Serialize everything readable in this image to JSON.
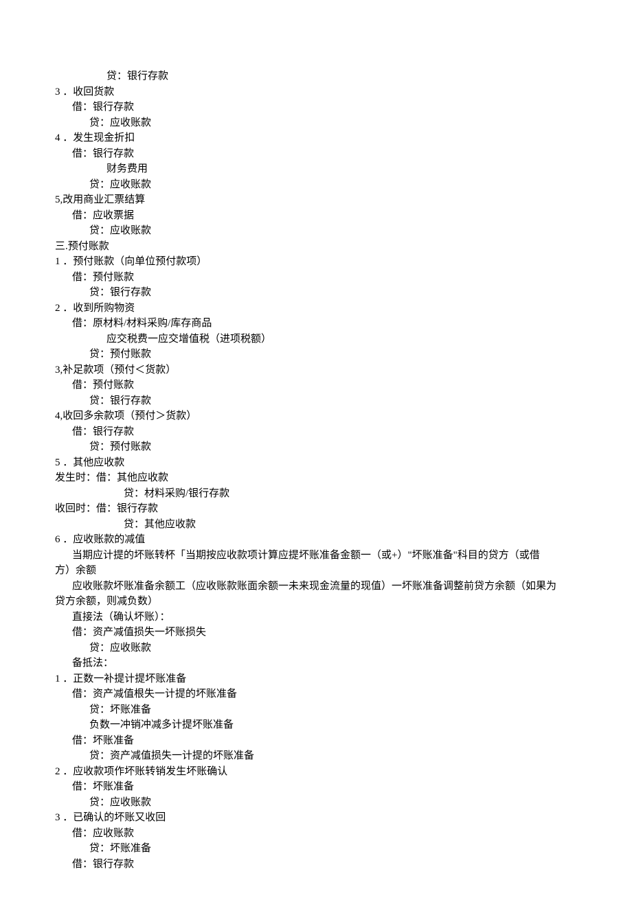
{
  "lines": [
    {
      "indent": 3,
      "text": "贷：银行存款"
    },
    {
      "indent": 0,
      "text": "3 ．收回货款"
    },
    {
      "indent": 1,
      "text": "借：银行存款"
    },
    {
      "indent": 2,
      "text": "贷：应收账款"
    },
    {
      "indent": 0,
      "text": "4 ．发生现金折扣"
    },
    {
      "indent": 1,
      "text": "借：银行存款"
    },
    {
      "indent": 3,
      "text": "财务费用"
    },
    {
      "indent": 2,
      "text": "贷：应收账款"
    },
    {
      "indent": 0,
      "text": "5,改用商业汇票结算"
    },
    {
      "indent": 1,
      "text": "借：应收票据"
    },
    {
      "indent": 2,
      "text": "贷：应收账款"
    },
    {
      "indent": 0,
      "text": "三.预付账款"
    },
    {
      "indent": 0,
      "text": "1 ．预付账款（向单位预付款项）"
    },
    {
      "indent": 1,
      "text": "借：预付账款"
    },
    {
      "indent": 2,
      "text": "贷：银行存款"
    },
    {
      "indent": 0,
      "text": "2 ．收到所购物资"
    },
    {
      "indent": 1,
      "text": "借：原材料/材料采购/库存商品"
    },
    {
      "indent": 3,
      "text": "应交税费一应交增值税（进项税额）"
    },
    {
      "indent": 2,
      "text": "贷：预付账款"
    },
    {
      "indent": 0,
      "text": "3,补足款项（预付＜货款）"
    },
    {
      "indent": 1,
      "text": "借：预付账款"
    },
    {
      "indent": 2,
      "text": "贷：银行存款"
    },
    {
      "indent": 0,
      "text": "4,收回多余款项（预付＞货款）"
    },
    {
      "indent": 1,
      "text": "借：银行存款"
    },
    {
      "indent": 2,
      "text": "贷：预付账款"
    },
    {
      "indent": 0,
      "text": "5 ．其他应收款"
    },
    {
      "indent": 0,
      "text": "发生时：借：其他应收款"
    },
    {
      "indent": 4,
      "text": "贷：材料采购/银行存款"
    },
    {
      "indent": 0,
      "text": "收回时：借：银行存款"
    },
    {
      "indent": 4,
      "text": "贷：其他应收款"
    },
    {
      "indent": 0,
      "text": "6 ．应收账款的减值"
    },
    {
      "indent": 1,
      "text": "当期应计提的坏账转杯「当期按应收款项计算应提坏账准备金额一（或+）\"坏账准备\"科目的贷方（或借"
    },
    {
      "indent": 0,
      "text": "方）余额"
    },
    {
      "indent": 1,
      "text": "应收账款坏账准备余额工（应收账款账面余额一未来现金流量的现值）一坏账准备调整前贷方余额（如果为"
    },
    {
      "indent": 0,
      "text": "贷方余额，则减负数）"
    },
    {
      "indent": 1,
      "text": "直接法（确认坏账）："
    },
    {
      "indent": 1,
      "text": "借：资产减值损失一坏账损失"
    },
    {
      "indent": 2,
      "text": "贷：应收账款"
    },
    {
      "indent": 1,
      "text": "备抵法："
    },
    {
      "indent": 0,
      "text": "1 ．正数一补提计提坏账准备"
    },
    {
      "indent": 1,
      "text": "借：资产减值根失一计提的坏账准备"
    },
    {
      "indent": 2,
      "text": "贷：坏账准备"
    },
    {
      "indent": 2,
      "text": "负数一冲销冲减多计提坏账准备"
    },
    {
      "indent": 1,
      "text": "借：坏账准备"
    },
    {
      "indent": 2,
      "text": "贷：资产减值损失一计提的坏账准备"
    },
    {
      "indent": 0,
      "text": "2 ．应收款项作坏账转销发生坏账确认"
    },
    {
      "indent": 1,
      "text": "借：坏账准备"
    },
    {
      "indent": 2,
      "text": "贷：应收账款"
    },
    {
      "indent": 0,
      "text": "3 ．已确认的坏账又收回"
    },
    {
      "indent": 1,
      "text": "借：应收账款"
    },
    {
      "indent": 2,
      "text": "贷：坏账准备"
    },
    {
      "indent": 1,
      "text": "借：银行存款"
    }
  ]
}
